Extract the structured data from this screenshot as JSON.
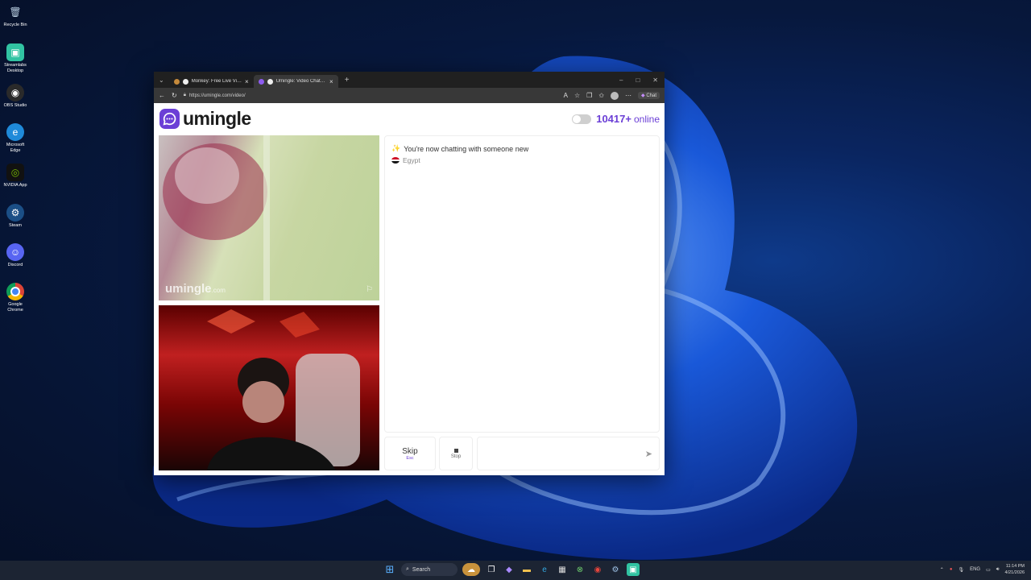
{
  "desktop": {
    "icons": [
      {
        "label": "Recycle Bin",
        "icon": "recycle-bin-icon",
        "color": "#8aa8c8"
      },
      {
        "label": "Streamlabs Desktop",
        "icon": "streamlabs-icon",
        "color": "#31c3a2"
      },
      {
        "label": "OBS Studio",
        "icon": "obs-icon",
        "color": "#3a3a3a"
      },
      {
        "label": "Microsoft Edge",
        "icon": "edge-icon",
        "color": "#1f8ad9"
      },
      {
        "label": "NVIDIA App",
        "icon": "nvidia-icon",
        "color": "#76b900"
      },
      {
        "label": "Steam",
        "icon": "steam-icon",
        "color": "#1b4f86"
      },
      {
        "label": "Discord",
        "icon": "discord-icon",
        "color": "#5865f2"
      },
      {
        "label": "Google Chrome",
        "icon": "chrome-icon",
        "color": "#db4437"
      }
    ]
  },
  "browser": {
    "tabs": [
      {
        "title": "Monkey: Free Live Video Chat",
        "active": false
      },
      {
        "title": "Umingle: Video Chat with Str",
        "active": true
      }
    ],
    "url": "https://umingle.com/video/",
    "copilot_label": "Chat"
  },
  "site": {
    "logo_text": "umingle",
    "online_count": "10417+",
    "online_label": "online",
    "watermark": "umingle",
    "watermark_suffix": ".com",
    "system_message": "You're now chatting with someone new",
    "partner_country": "Egypt",
    "skip_label": "Skip",
    "skip_hint": "Esc",
    "stop_label": "Stop",
    "accent_color": "#6b3fd6"
  },
  "taskbar": {
    "search_label": "Search",
    "language": "ENG",
    "time": "11:14 PM",
    "date": "4/21/2026"
  }
}
